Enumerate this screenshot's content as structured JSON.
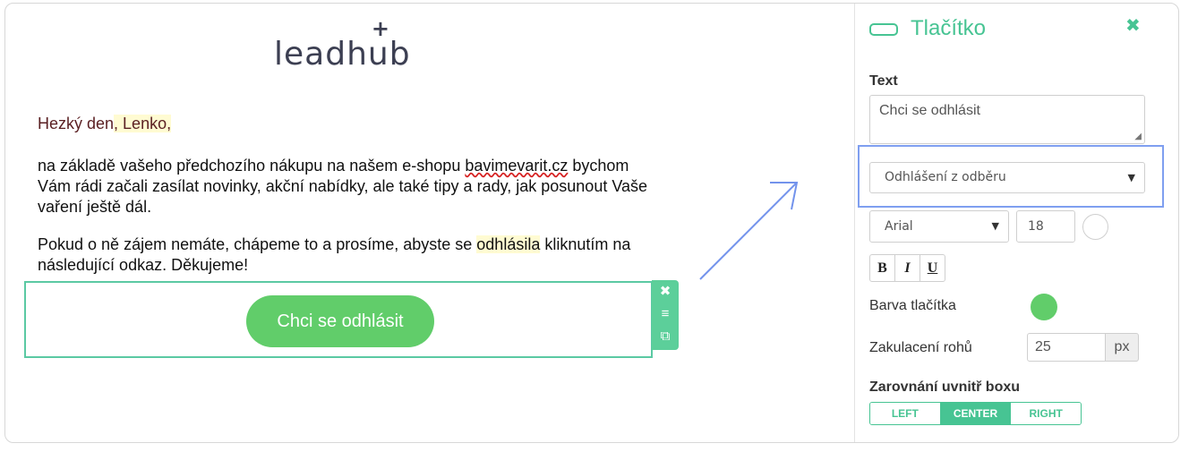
{
  "editor": {
    "logo_text": "leadhub",
    "greeting": {
      "start": "Hezký den",
      "highlight": ", Lenko,"
    },
    "paragraph1": {
      "before": "na základě vašeho předchozího nákupu na našem e-shopu ",
      "link": "bavimevarit.cz",
      "after": " bychom Vám rádi začali zasílat novinky, akční nabídky, ale také tipy a rady, jak posunout Vaše vaření ještě dál."
    },
    "paragraph2": {
      "before": "Pokud o ně zájem nemáte, chápeme to a prosíme, abyste se ",
      "highlight": "odhlásila",
      "after": " kliknutím na následující odkaz. Děkujeme!"
    },
    "cta_button_label": "Chci se odhlásit",
    "block_tools": {
      "remove_icon": "✖",
      "move_icon": "≡",
      "duplicate_icon": "⧉"
    }
  },
  "panel": {
    "title": "Tlačítko",
    "close_icon": "✖",
    "text_label": "Text",
    "text_value": "Chci se odhlásit",
    "action_select": "Odhlášení z odběru",
    "font_select": "Arial",
    "font_size": "18",
    "format_buttons": [
      "B",
      "I",
      "U"
    ],
    "button_color_label": "Barva tlačítka",
    "button_color": "#61cd6a",
    "corner_label": "Zakulacení rohů",
    "corner_value": "25",
    "corner_unit": "px",
    "align_label": "Zarovnání uvnitř boxu",
    "align_options": [
      "LEFT",
      "CENTER",
      "RIGHT"
    ],
    "align_selected": "CENTER",
    "accent_color": "#47c493"
  }
}
